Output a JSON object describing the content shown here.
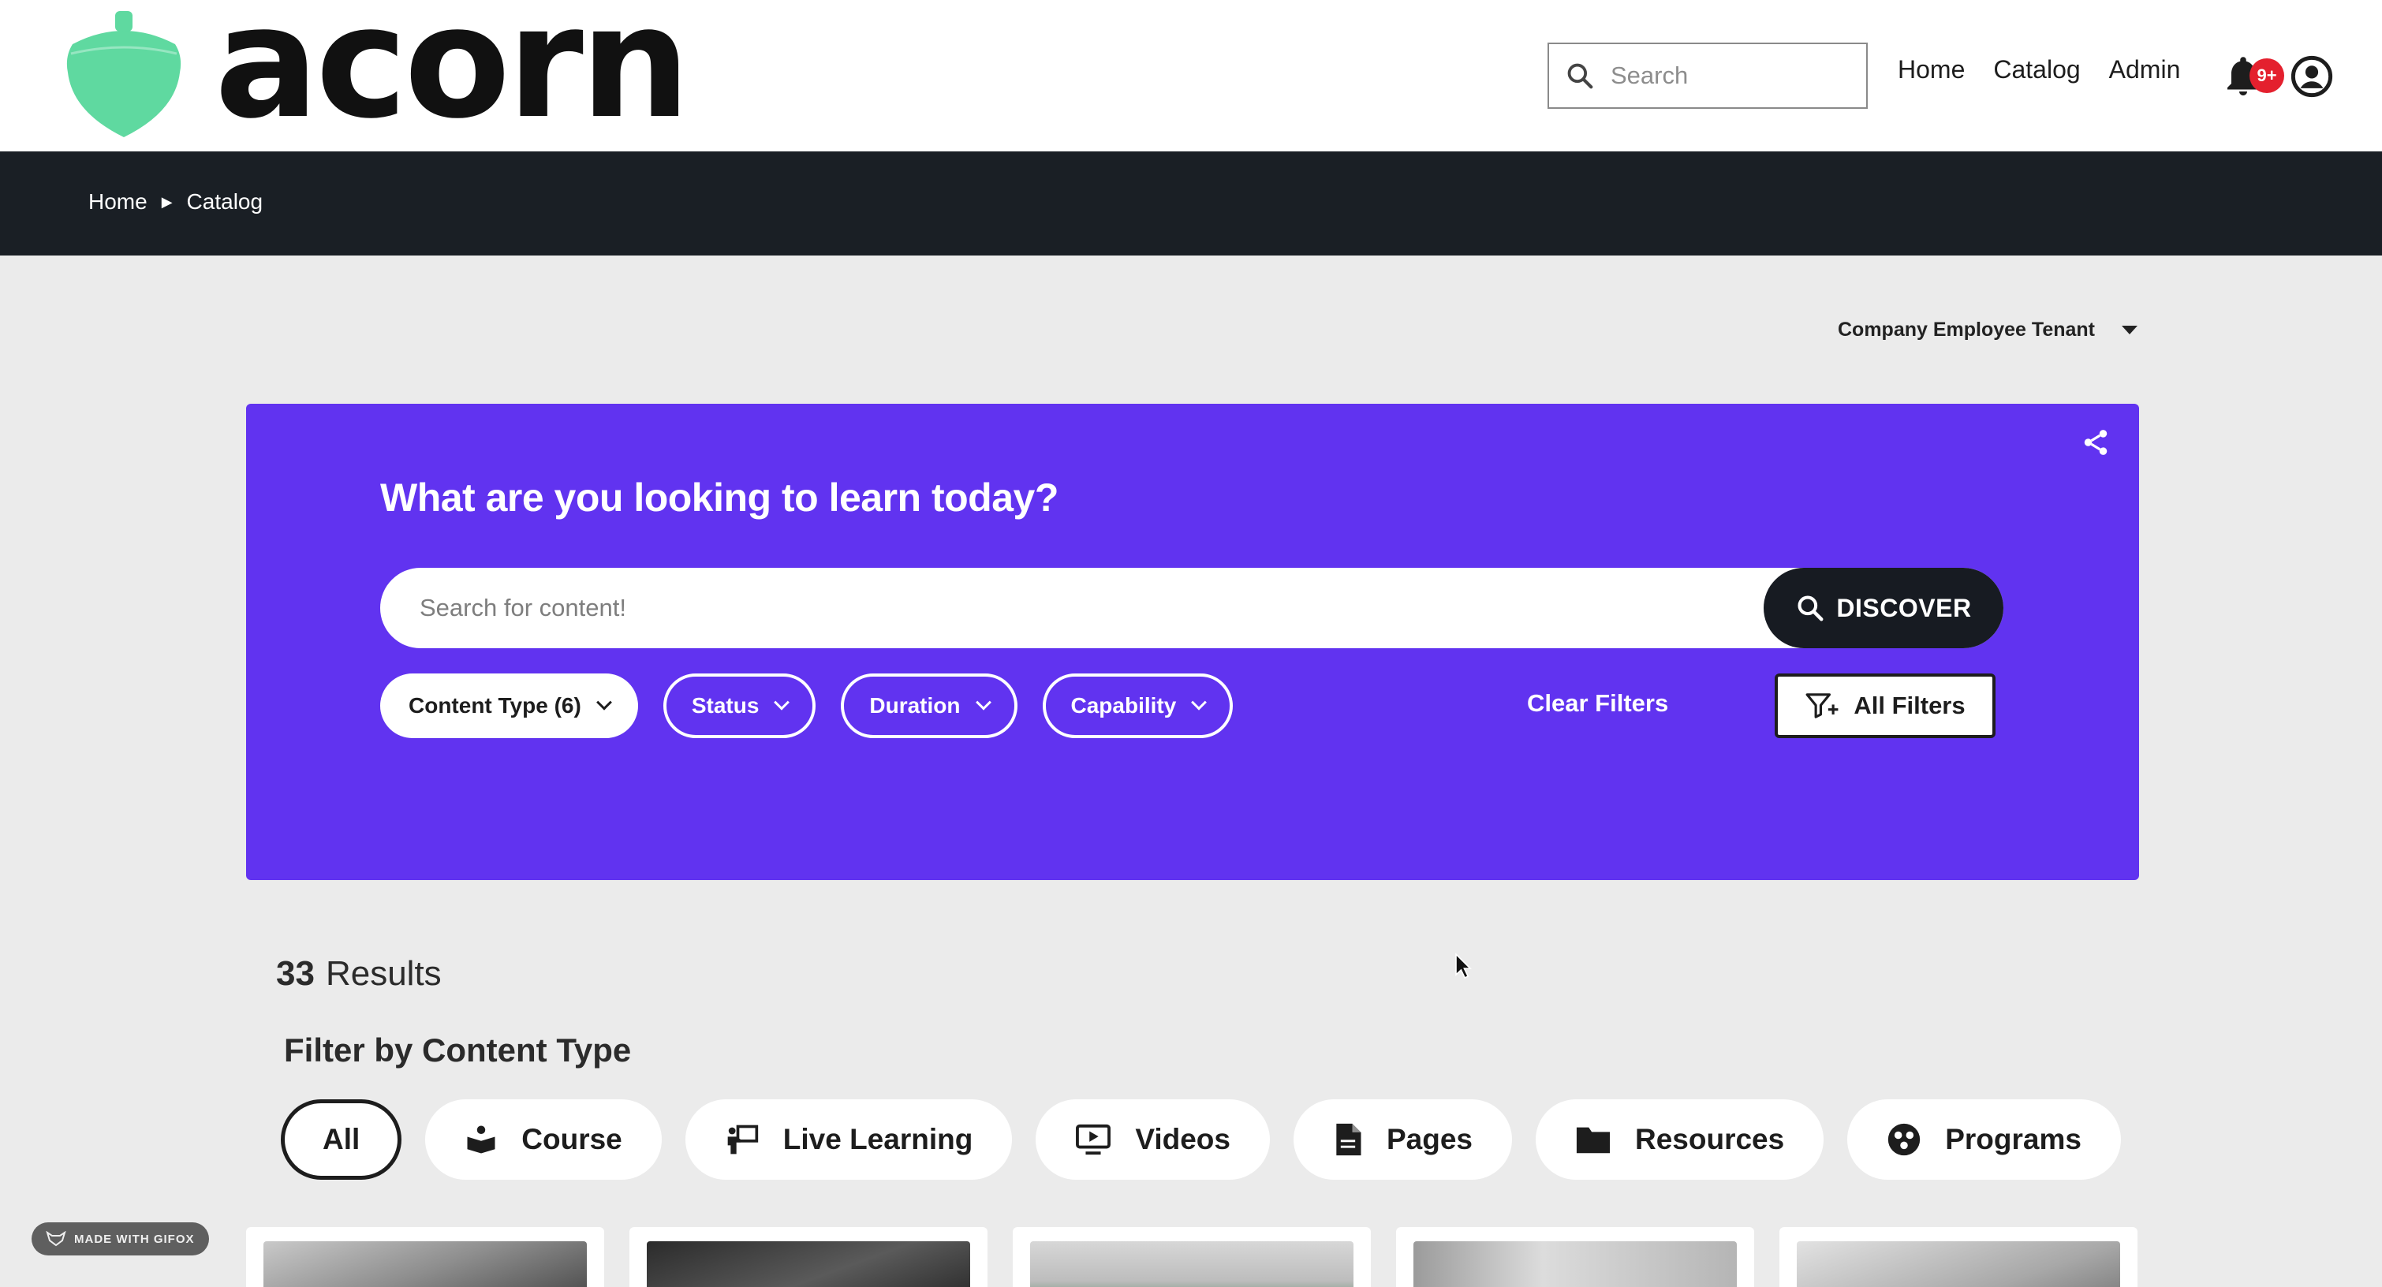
{
  "app": {
    "logo_text": "acorn",
    "brand_color": "#5fd9a0"
  },
  "header": {
    "search_placeholder": "Search",
    "nav": [
      "Home",
      "Catalog",
      "Admin"
    ],
    "notification_badge": "9+"
  },
  "breadcrumb": {
    "items": [
      "Home",
      "Catalog"
    ]
  },
  "tenant": {
    "label": "Company Employee Tenant"
  },
  "hero": {
    "title": "What are you looking to learn today?",
    "search_placeholder": "Search for content!",
    "discover_label": "DISCOVER",
    "filters": [
      {
        "label": "Content Type (6)",
        "active": true
      },
      {
        "label": "Status",
        "active": false
      },
      {
        "label": "Duration",
        "active": false
      },
      {
        "label": "Capability",
        "active": false
      }
    ],
    "clear_filters": "Clear Filters",
    "all_filters": "All Filters",
    "background": "#6133f0"
  },
  "results": {
    "count": "33",
    "label": "Results"
  },
  "content_type_filter": {
    "heading": "Filter by Content Type",
    "types": [
      {
        "label": "All",
        "icon": "none",
        "selected": true
      },
      {
        "label": "Course",
        "icon": "course-icon",
        "selected": false
      },
      {
        "label": "Live Learning",
        "icon": "presenter-icon",
        "selected": false
      },
      {
        "label": "Videos",
        "icon": "video-icon",
        "selected": false
      },
      {
        "label": "Pages",
        "icon": "document-icon",
        "selected": false
      },
      {
        "label": "Resources",
        "icon": "folder-icon",
        "selected": false
      },
      {
        "label": "Programs",
        "icon": "programs-icon",
        "selected": false
      }
    ]
  },
  "watermark": {
    "text": "MADE WITH GIFOX"
  }
}
